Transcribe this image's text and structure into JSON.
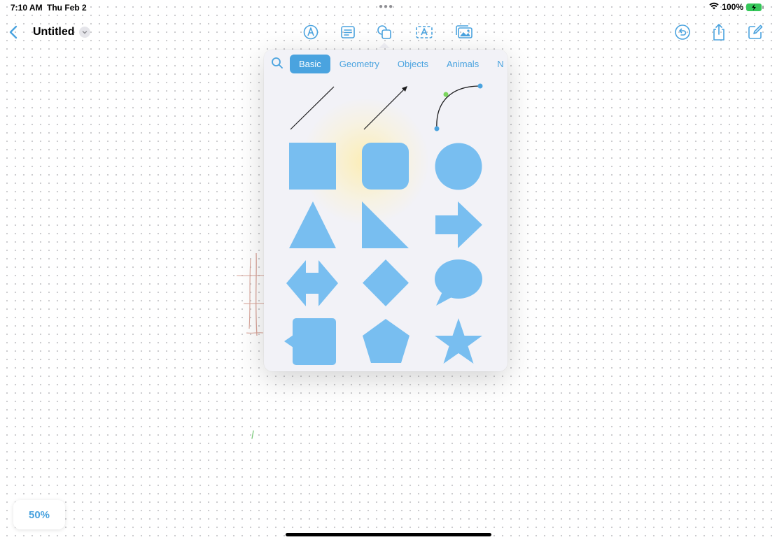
{
  "status_bar": {
    "time": "7:10 AM",
    "date": "Thu Feb 2",
    "battery": "100%"
  },
  "toolbar": {
    "title": "Untitled"
  },
  "shapes_popover": {
    "tabs": [
      {
        "label": "Basic",
        "active": true
      },
      {
        "label": "Geometry",
        "active": false
      },
      {
        "label": "Objects",
        "active": false
      },
      {
        "label": "Animals",
        "active": false
      },
      {
        "label": "N",
        "active": false
      }
    ],
    "shapes": [
      "line",
      "arrow",
      "curve",
      "square",
      "rounded-square",
      "circle",
      "triangle",
      "right-triangle",
      "arrow-right",
      "double-arrow",
      "diamond",
      "speech-bubble",
      "callout-square",
      "pentagon",
      "star"
    ],
    "shape_color": "#78bef0"
  },
  "zoom": {
    "label": "50%"
  },
  "colors": {
    "accent": "#4aa3df",
    "shape_fill": "#78bef0"
  }
}
